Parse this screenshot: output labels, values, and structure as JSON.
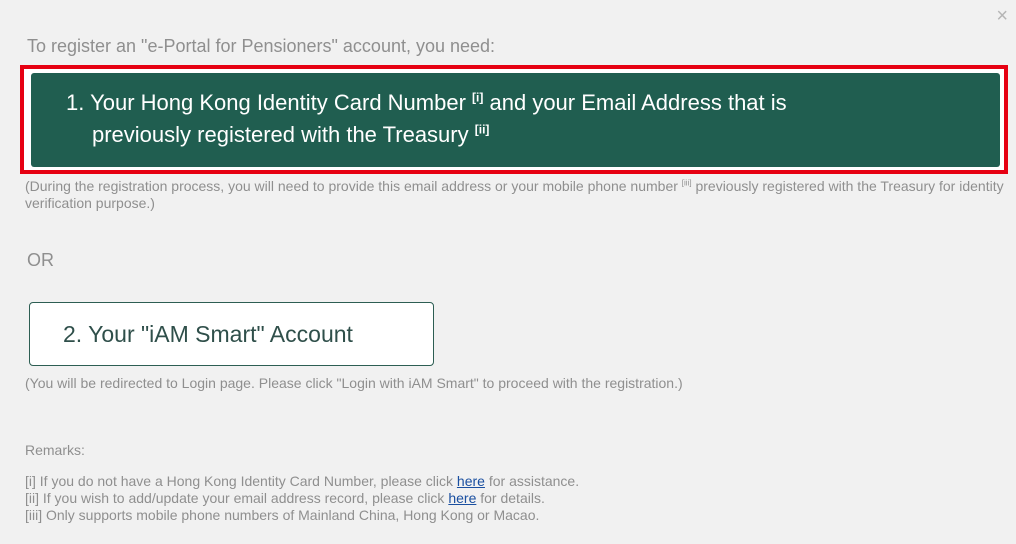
{
  "dialog": {
    "close_symbol": "×",
    "intro": "To register an \"e-Portal for Pensioners\" account, you need:",
    "option1": {
      "line1": "1. Your Hong Kong Identity Card Number",
      "sup1": "[i]",
      "line1b": "and your Email Address that is",
      "line2": "previously registered with the Treasury",
      "sup2": "[ii]"
    },
    "note1": {
      "text_a": "(During the registration process, you will need to provide this email address or your mobile phone number",
      "sup": "[iii]",
      "text_b": "previously registered with the Treasury for identity verification purpose.)"
    },
    "or_label": "OR",
    "option2": {
      "label": "2. Your \"iAM Smart\" Account"
    },
    "note2": "(You will be redirected to Login page. Please click \"Login with iAM Smart\" to proceed with the registration.)",
    "remarks": {
      "title": "Remarks:",
      "r1_before": "[i] If you do not have a Hong Kong Identity Card Number, please click",
      "r1_link": "here",
      "r1_after": "for assistance.",
      "r2_before": "[ii] If you wish to add/update your email address record, please click",
      "r2_link": "here",
      "r2_after": "for details.",
      "r3": "[iii] Only supports mobile phone numbers of Mainland China, Hong Kong or Macao."
    }
  },
  "colors": {
    "background": "#f1f1f1",
    "primary_green": "#205e50",
    "highlight_red": "#e60012",
    "link_blue": "#1a4fa0"
  }
}
